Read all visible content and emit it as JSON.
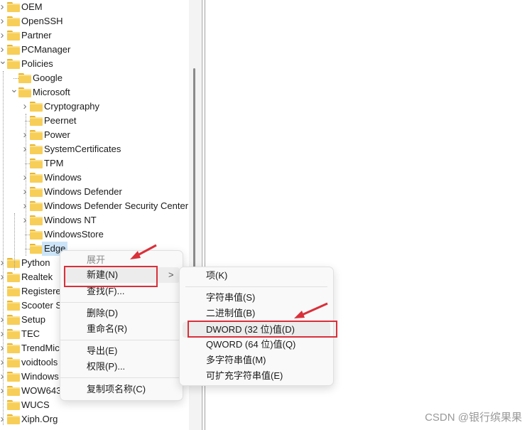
{
  "tree": [
    {
      "label": "OEM",
      "level": 0,
      "chevron": ">"
    },
    {
      "label": "OpenSSH",
      "level": 0,
      "chevron": ">"
    },
    {
      "label": "Partner",
      "level": 0,
      "chevron": ">"
    },
    {
      "label": "PCManager",
      "level": 0,
      "chevron": ">"
    },
    {
      "label": "Policies",
      "level": 0,
      "chevron": "v"
    },
    {
      "label": "Google",
      "level": 1,
      "chevron": ""
    },
    {
      "label": "Microsoft",
      "level": 1,
      "chevron": "v"
    },
    {
      "label": "Cryptography",
      "level": 2,
      "chevron": ">"
    },
    {
      "label": "Peernet",
      "level": 2,
      "chevron": ""
    },
    {
      "label": "Power",
      "level": 2,
      "chevron": ">"
    },
    {
      "label": "SystemCertificates",
      "level": 2,
      "chevron": ">"
    },
    {
      "label": "TPM",
      "level": 2,
      "chevron": ""
    },
    {
      "label": "Windows",
      "level": 2,
      "chevron": ">"
    },
    {
      "label": "Windows Defender",
      "level": 2,
      "chevron": ">"
    },
    {
      "label": "Windows Defender Security Center",
      "level": 2,
      "chevron": ">"
    },
    {
      "label": "Windows NT",
      "level": 2,
      "chevron": ">"
    },
    {
      "label": "WindowsStore",
      "level": 2,
      "chevron": ""
    },
    {
      "label": "Edge",
      "level": 2,
      "chevron": "",
      "selected": true
    },
    {
      "label": "Python",
      "level": 0,
      "chevron": ">"
    },
    {
      "label": "Realtek",
      "level": 0,
      "chevron": ">"
    },
    {
      "label": "Registere",
      "level": 0,
      "chevron": ""
    },
    {
      "label": "Scooter S",
      "level": 0,
      "chevron": ""
    },
    {
      "label": "Setup",
      "level": 0,
      "chevron": ">"
    },
    {
      "label": "TEC",
      "level": 0,
      "chevron": ">"
    },
    {
      "label": "TrendMic",
      "level": 0,
      "chevron": ">"
    },
    {
      "label": "voidtools",
      "level": 0,
      "chevron": ">"
    },
    {
      "label": "Windows",
      "level": 0,
      "chevron": ">"
    },
    {
      "label": "WOW643",
      "level": 0,
      "chevron": ">"
    },
    {
      "label": "WUCS",
      "level": 0,
      "chevron": ""
    },
    {
      "label": "Xiph.Org",
      "level": 0,
      "chevron": ">"
    }
  ],
  "context_menu": {
    "expand": "展开",
    "new": "新建(N)",
    "new_arrow": ">",
    "find": "查找(F)...",
    "delete": "删除(D)",
    "rename": "重命名(R)",
    "export": "导出(E)",
    "permissions": "权限(P)...",
    "copy_key_name": "复制项名称(C)"
  },
  "submenu": {
    "key": "项(K)",
    "string": "字符串值(S)",
    "binary": "二进制值(B)",
    "dword": "DWORD (32 位)值(D)",
    "qword": "QWORD (64 位)值(Q)",
    "multi_string": "多字符串值(M)",
    "expandable_string": "可扩充字符串值(E)"
  },
  "annotation_color": "#d9303a",
  "watermark": "CSDN @银行缤果果"
}
